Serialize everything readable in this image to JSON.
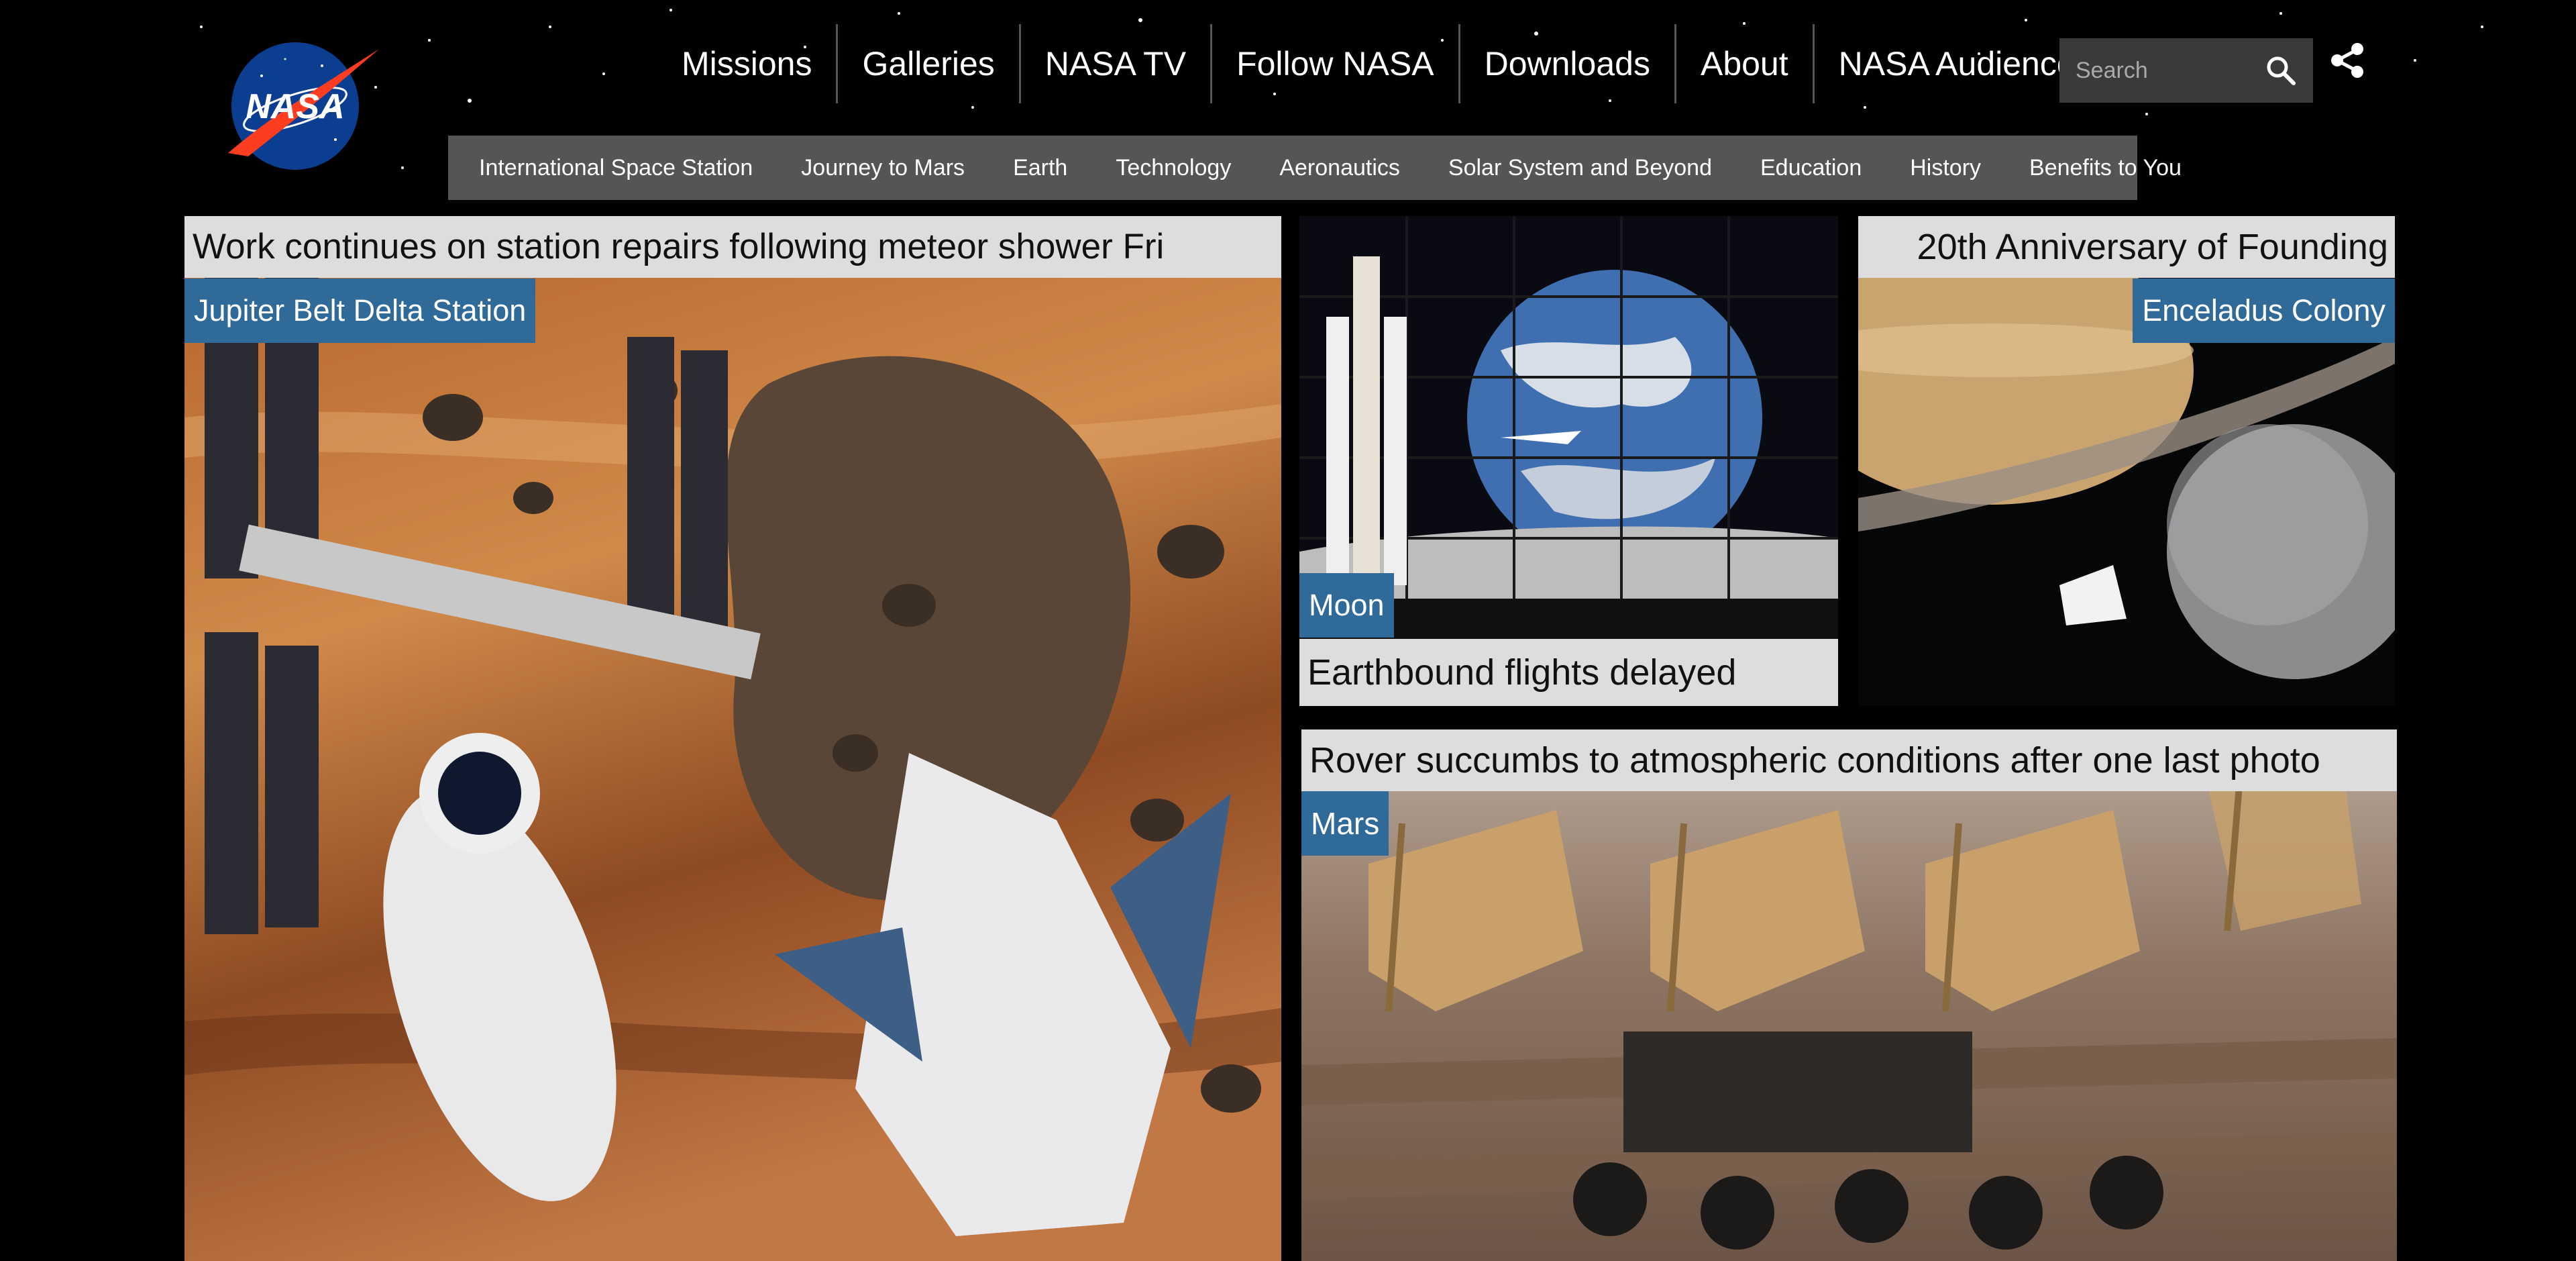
{
  "brand": {
    "logo_text": "NASA"
  },
  "main_nav": [
    "Missions",
    "Galleries",
    "NASA TV",
    "Follow NASA",
    "Downloads",
    "About",
    "NASA Audiences"
  ],
  "search": {
    "placeholder": "Search"
  },
  "sub_nav": [
    "International Space Station",
    "Journey to Mars",
    "Earth",
    "Technology",
    "Aeronautics",
    "Solar System and Beyond",
    "Education",
    "History",
    "Benefits to You"
  ],
  "tiles": {
    "station": {
      "headline": "Work continues on station repairs following meteor shower Fri",
      "location": "Jupiter Belt Delta Station"
    },
    "moon": {
      "headline": "Earthbound flights delayed",
      "location": "Moon"
    },
    "enceladus": {
      "headline": "20th Anniversary of Founding",
      "location": "Enceladus Colony"
    },
    "mars": {
      "headline": "Rover succumbs to atmospheric conditions after one last photo",
      "location": "Mars"
    }
  },
  "colors": {
    "tag_blue": "#2f6a99",
    "headline_bg": "#dddddd",
    "subnav_bg": "#555555",
    "nasa_blue": "#0b3d91",
    "nasa_red": "#fc3d21"
  },
  "icons": {
    "search": "search-icon",
    "share": "share-icon"
  }
}
